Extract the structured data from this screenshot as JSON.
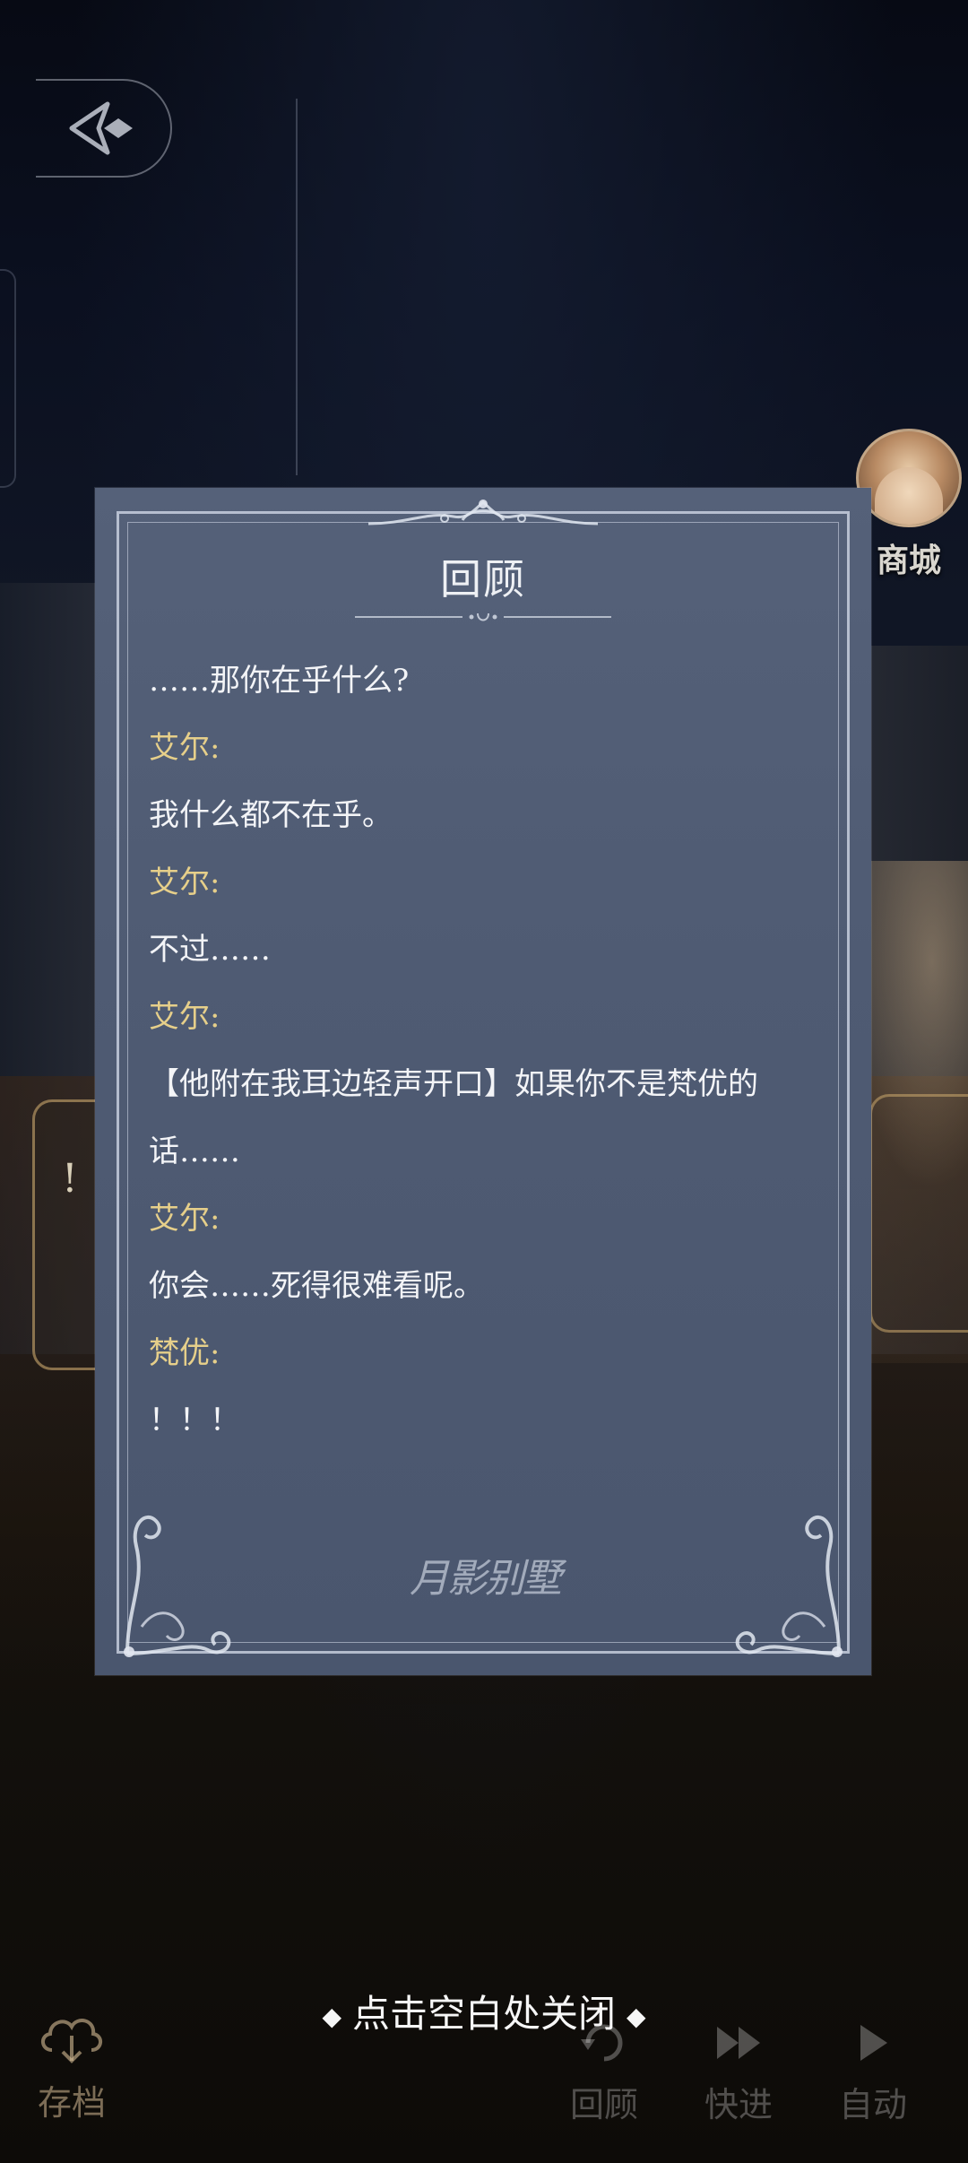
{
  "review": {
    "title": "回顾",
    "lines": [
      {
        "type": "text",
        "content": "……那你在乎什么?"
      },
      {
        "type": "speaker",
        "content": "艾尔:"
      },
      {
        "type": "text",
        "content": "我什么都不在乎。"
      },
      {
        "type": "speaker",
        "content": "艾尔:"
      },
      {
        "type": "text",
        "content": "不过……"
      },
      {
        "type": "speaker",
        "content": "艾尔:"
      },
      {
        "type": "text",
        "content": "【他附在我耳边轻声开口】如果你不是梵优的话……"
      },
      {
        "type": "speaker",
        "content": "艾尔:"
      },
      {
        "type": "text",
        "content": "你会……死得很难看呢。"
      },
      {
        "type": "speaker",
        "content": "梵优:"
      },
      {
        "type": "text",
        "content": "！！！"
      }
    ],
    "watermark": "月影别墅"
  },
  "shop": {
    "label": "商城"
  },
  "side_card": {
    "mark": "!"
  },
  "close_hint": {
    "text": "点击空白处关闭"
  },
  "bottom_bar": {
    "save": "存档",
    "review": "回顾",
    "skip": "快进",
    "auto": "自动"
  },
  "colors": {
    "panel": "#525e76",
    "speaker": "#e6cf8a",
    "text": "#f3f4f7"
  }
}
